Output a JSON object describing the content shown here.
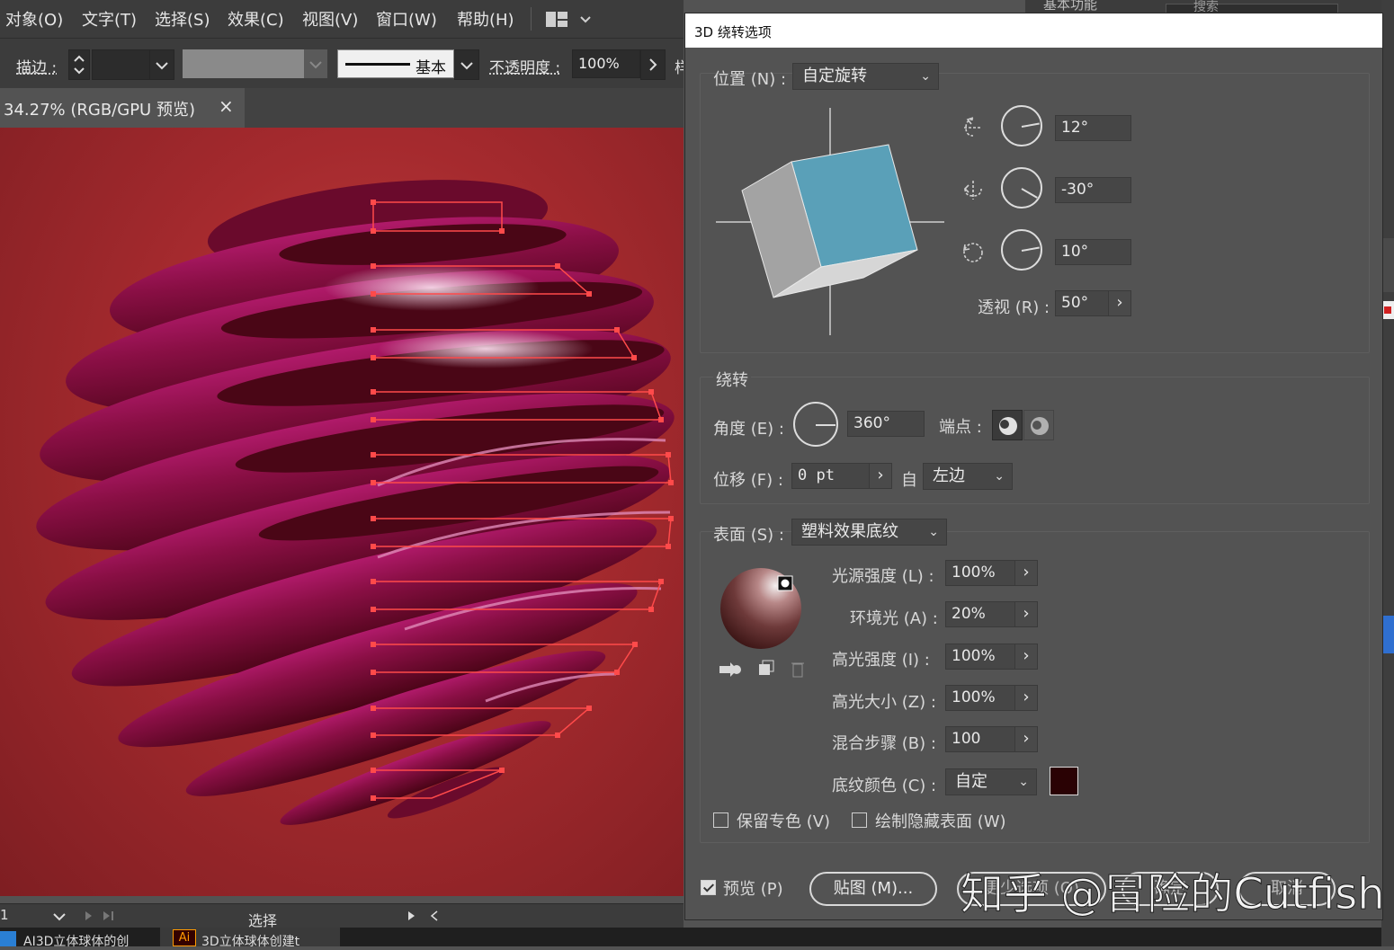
{
  "menubar": {
    "items": [
      "对象(O)",
      "文字(T)",
      "选择(S)",
      "效果(C)",
      "视图(V)",
      "窗口(W)",
      "帮助(H)"
    ]
  },
  "controlbar": {
    "stroke_label": "描边 :",
    "brush_label": "基本",
    "opacity_label": "不透明度 :",
    "opacity_value": "100%",
    "style_label_partial": "样"
  },
  "document_tab": {
    "title": "34.27% (RGB/GPU 预览)",
    "close": "×"
  },
  "statusbar": {
    "page": "1",
    "tool": "选择"
  },
  "topright": {
    "workspace_partial": "基本功能",
    "search_partial": "搜索"
  },
  "taskbar": {
    "item1": "AI3D立体球体的创",
    "item2_icon": "Ai",
    "item2": "3D立体球体创建t"
  },
  "dialog": {
    "title": "3D 绕转选项",
    "position": {
      "label": "位置 (N) :",
      "value": "自定旋转",
      "x_rotation": "12°",
      "y_rotation": "-30°",
      "z_rotation": "10°",
      "perspective_label": "透视 (R) :",
      "perspective_value": "50°"
    },
    "revolve": {
      "header": "绕转",
      "angle_label": "角度 (E) :",
      "angle_value": "360°",
      "cap_label": "端点 :",
      "offset_label": "位移 (F) :",
      "offset_value": "0 pt",
      "from_label": "自",
      "from_value": "左边"
    },
    "surface": {
      "label": "表面 (S) :",
      "value": "塑料效果底纹",
      "light_intensity_label": "光源强度 (L) :",
      "light_intensity_value": "100%",
      "ambient_label": "环境光 (A) :",
      "ambient_value": "20%",
      "highlight_intensity_label": "高光强度 (I) :",
      "highlight_intensity_value": "100%",
      "highlight_size_label": "高光大小 (Z) :",
      "highlight_size_value": "100%",
      "blend_steps_label": "混合步骤 (B) :",
      "blend_steps_value": "100",
      "shade_color_label": "底纹颜色 (C) :",
      "shade_color_value": "自定",
      "shade_color_swatch": "#2a0204"
    },
    "preserve_spot_label": "保留专色 (V)",
    "draw_hidden_label": "绘制隐藏表面 (W)",
    "preview_label": "预览 (P)",
    "map_art_button": "贴图 (M)...",
    "fewer_options_button": "更少选项 (O)",
    "ok_button": "确定",
    "cancel_button": "取消"
  },
  "watermark": "知乎 @冒险的Cutfish",
  "colors": {
    "cube_front": "#5aa0b8",
    "cube_side": "#a3a3a3",
    "sphere_dark": "#4a0416",
    "sphere_mid": "#8a0f45",
    "selection": "#ff4a4a"
  }
}
